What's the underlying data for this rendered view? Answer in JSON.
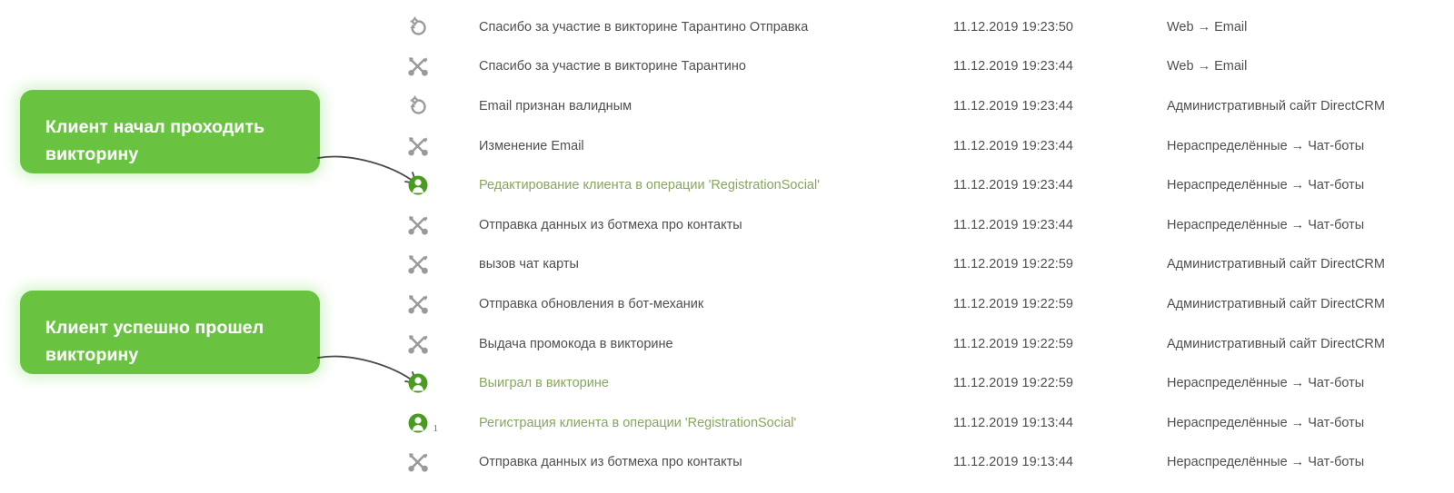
{
  "callouts": [
    {
      "id": "callout-started",
      "text": "Клиент начал проходить викторину",
      "color": "#69c341"
    },
    {
      "id": "callout-finished",
      "text": "Клиент успешно прошел викторину",
      "color": "#69c341"
    }
  ],
  "colors": {
    "callout_green": "#69c341",
    "icon_green": "#4a9b1f",
    "green_text": "#86a75e",
    "body_text": "#4f4f4f",
    "icon_gray": "#9a9a9a"
  },
  "table": {
    "rows": [
      {
        "icon": "history-gear-icon",
        "highlighted": false,
        "title": "Спасибо за участие в викторине Тарантино Отправка",
        "date": "11.12.2019 19:23:50",
        "source": "Web → Email"
      },
      {
        "icon": "tools-icon",
        "highlighted": false,
        "title": "Спасибо за участие в викторине Тарантино",
        "date": "11.12.2019 19:23:44",
        "source": "Web → Email"
      },
      {
        "icon": "history-gear-icon",
        "highlighted": false,
        "title": "Email признан валидным",
        "date": "11.12.2019 19:23:44",
        "source": "Административный сайт DirectCRM"
      },
      {
        "icon": "tools-icon",
        "highlighted": false,
        "title": "Изменение Email",
        "date": "11.12.2019 19:23:44",
        "source": "Нераспределённые → Чат-боты"
      },
      {
        "icon": "person-icon",
        "highlighted": true,
        "title": "Редактирование клиента в операции 'RegistrationSocial'",
        "date": "11.12.2019 19:23:44",
        "source": "Нераспределённые → Чат-боты"
      },
      {
        "icon": "tools-icon",
        "highlighted": false,
        "title": "Отправка данных из ботмеха про контакты",
        "date": "11.12.2019 19:23:44",
        "source": "Нераспределённые → Чат-боты"
      },
      {
        "icon": "tools-icon",
        "highlighted": false,
        "title": "вызов чат карты",
        "date": "11.12.2019 19:22:59",
        "source": "Административный сайт DirectCRM"
      },
      {
        "icon": "tools-icon",
        "highlighted": false,
        "title": "Отправка обновления в бот-механик",
        "date": "11.12.2019 19:22:59",
        "source": "Административный сайт DirectCRM"
      },
      {
        "icon": "tools-icon",
        "highlighted": false,
        "title": "Выдача промокода в викторине",
        "date": "11.12.2019 19:22:59",
        "source": "Административный сайт DirectCRM"
      },
      {
        "icon": "person-icon",
        "highlighted": true,
        "title": "Выиграл в викторине",
        "date": "11.12.2019 19:22:59",
        "source": "Нераспределённые → Чат-боты"
      },
      {
        "icon": "person-plus-icon",
        "highlighted": true,
        "title": "Регистрация клиента в операции 'RegistrationSocial'",
        "date": "11.12.2019 19:13:44",
        "source": "Нераспределённые → Чат-боты"
      },
      {
        "icon": "tools-icon",
        "highlighted": false,
        "title": "Отправка данных из ботмеха про контакты",
        "date": "11.12.2019 19:13:44",
        "source": "Нераспределённые → Чат-боты"
      }
    ]
  }
}
